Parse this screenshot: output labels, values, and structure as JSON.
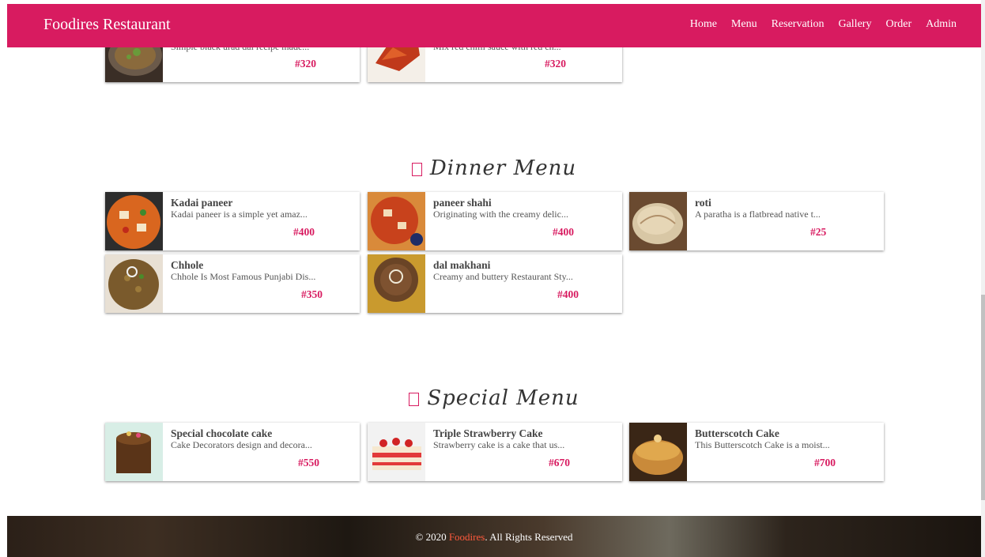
{
  "navbar": {
    "brand": "Foodires Restaurant",
    "links": [
      "Home",
      "Menu",
      "Reservation",
      "Gallery",
      "Order",
      "Admin"
    ]
  },
  "partial_cards": [
    {
      "desc": "Simple black urad dal recipe made...",
      "price": "#320"
    },
    {
      "desc": "Mix red chilli sauce with red ch...",
      "price": "#320"
    }
  ],
  "dinner": {
    "heading": "Dinner Menu",
    "items": [
      {
        "title": "Kadai paneer",
        "desc": "Kadai paneer is a simple yet amaz...",
        "price": "#400"
      },
      {
        "title": "paneer shahi",
        "desc": "Originating with the creamy delic...",
        "price": "#400"
      },
      {
        "title": "roti",
        "desc": "A paratha is a flatbread native t...",
        "price": "#25"
      },
      {
        "title": "Chhole",
        "desc": "Chhole Is Most Famous Punjabi Dis...",
        "price": "#350"
      },
      {
        "title": "dal makhani",
        "desc": "Creamy and buttery Restaurant Sty...",
        "price": "#400"
      }
    ]
  },
  "special": {
    "heading": "Special Menu",
    "items": [
      {
        "title": "Special chocolate cake",
        "desc": "Cake Decorators design and decora...",
        "price": "#550"
      },
      {
        "title": "Triple Strawberry Cake",
        "desc": "Strawberry cake is a cake that us...",
        "price": "#670"
      },
      {
        "title": "Butterscotch Cake",
        "desc": "This Butterscotch Cake is a moist...",
        "price": "#700"
      }
    ]
  },
  "footer": {
    "prefix": "© 2020 ",
    "brand": "Foodires",
    "suffix": ". All Rights Reserved"
  }
}
